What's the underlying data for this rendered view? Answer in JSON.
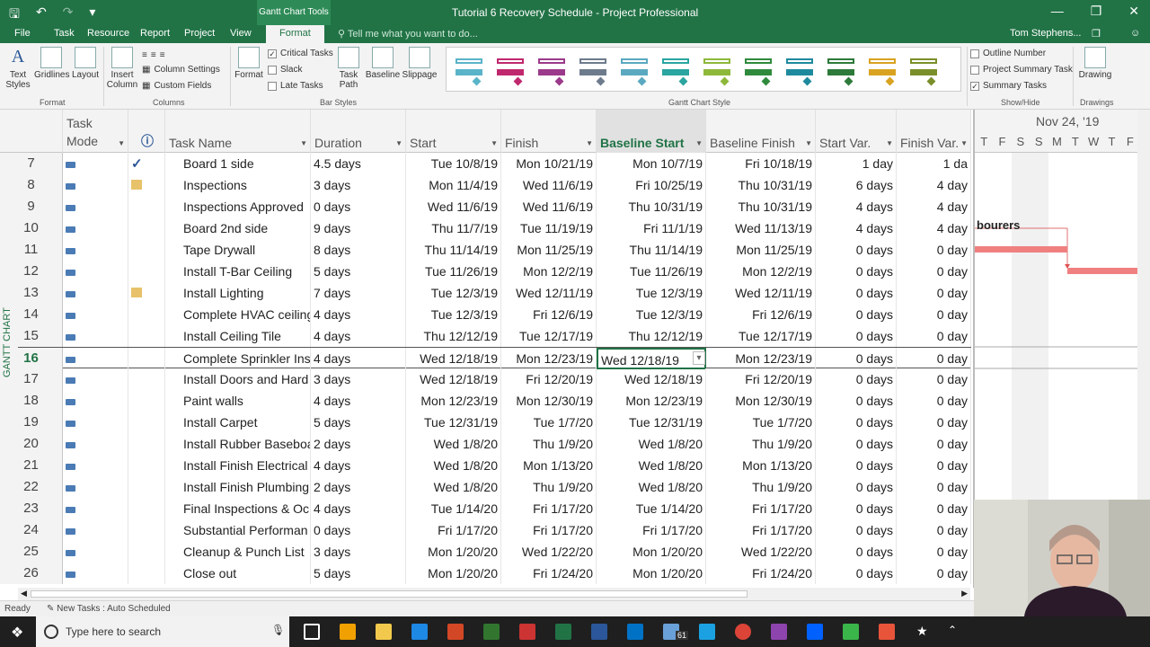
{
  "window": {
    "title": "Tutorial 6 Recovery Schedule - Project Professional",
    "context_tab": "Gantt Chart Tools"
  },
  "tabs": [
    {
      "label": "File"
    },
    {
      "label": "Task"
    },
    {
      "label": "Resource"
    },
    {
      "label": "Report"
    },
    {
      "label": "Project"
    },
    {
      "label": "View"
    },
    {
      "label": "Format"
    }
  ],
  "tell_me": "Tell me what you want to do...",
  "user": "Tom Stephens...",
  "ribbon": {
    "format": {
      "text_styles": "Text Styles",
      "gridlines": "Gridlines",
      "layout": "Layout",
      "label": "Format"
    },
    "columns": {
      "insert_column": "Insert Column",
      "column_settings": "Column Settings",
      "custom_fields": "Custom Fields",
      "label": "Columns"
    },
    "bar_styles": {
      "format": "Format",
      "critical_tasks": "Critical Tasks",
      "slack": "Slack",
      "late_tasks": "Late Tasks",
      "task_path": "Task Path",
      "baseline": "Baseline",
      "slippage": "Slippage",
      "label": "Bar Styles"
    },
    "gantt_style": {
      "label": "Gantt Chart Style",
      "colors": [
        "#5ab4c9",
        "#c0286e",
        "#9b3a8a",
        "#6d7b8c",
        "#5aa9c0",
        "#2aa5a0",
        "#8db83a",
        "#2f8a3c",
        "#1f8a9e",
        "#2d7a3a",
        "#d9a321",
        "#7a8f2a"
      ]
    },
    "show_hide": {
      "outline_number": "Outline Number",
      "project_summary": "Project Summary Task",
      "summary_tasks": "Summary Tasks",
      "label": "Show/Hide"
    },
    "drawings": {
      "drawing": "Drawing",
      "label": "Drawings"
    }
  },
  "columns": {
    "task_mode": "Task Mode",
    "task_name": "Task Name",
    "duration": "Duration",
    "start": "Start",
    "finish": "Finish",
    "baseline_start": "Baseline Start",
    "baseline_finish": "Baseline Finish",
    "start_var": "Start Var.",
    "finish_var": "Finish Var."
  },
  "rows": [
    {
      "id": "7",
      "info": "check",
      "name": "Board 1 side",
      "duration": "4.5 days",
      "start": "Tue 10/8/19",
      "finish": "Mon 10/21/19",
      "bstart": "Mon 10/7/19",
      "bfinish": "Fri 10/18/19",
      "svar": "1 day",
      "fvar": "1 da"
    },
    {
      "id": "8",
      "info": "note",
      "name": "Inspections",
      "duration": "3 days",
      "start": "Mon 11/4/19",
      "finish": "Wed 11/6/19",
      "bstart": "Fri 10/25/19",
      "bfinish": "Thu 10/31/19",
      "svar": "6 days",
      "fvar": "4 day"
    },
    {
      "id": "9",
      "info": "",
      "name": "Inspections Approved",
      "duration": "0 days",
      "start": "Wed 11/6/19",
      "finish": "Wed 11/6/19",
      "bstart": "Thu 10/31/19",
      "bfinish": "Thu 10/31/19",
      "svar": "4 days",
      "fvar": "4 day"
    },
    {
      "id": "10",
      "info": "",
      "name": "Board 2nd side",
      "duration": "9 days",
      "start": "Thu 11/7/19",
      "finish": "Tue 11/19/19",
      "bstart": "Fri 11/1/19",
      "bfinish": "Wed 11/13/19",
      "svar": "4 days",
      "fvar": "4 day"
    },
    {
      "id": "11",
      "info": "",
      "name": "Tape Drywall",
      "duration": "8 days",
      "start": "Thu 11/14/19",
      "finish": "Mon 11/25/19",
      "bstart": "Thu 11/14/19",
      "bfinish": "Mon 11/25/19",
      "svar": "0 days",
      "fvar": "0 day"
    },
    {
      "id": "12",
      "info": "",
      "name": "Install T-Bar Ceiling",
      "duration": "5 days",
      "start": "Tue 11/26/19",
      "finish": "Mon 12/2/19",
      "bstart": "Tue 11/26/19",
      "bfinish": "Mon 12/2/19",
      "svar": "0 days",
      "fvar": "0 day"
    },
    {
      "id": "13",
      "info": "note",
      "name": "Install Lighting",
      "duration": "7 days",
      "start": "Tue 12/3/19",
      "finish": "Wed 12/11/19",
      "bstart": "Tue 12/3/19",
      "bfinish": "Wed 12/11/19",
      "svar": "0 days",
      "fvar": "0 day"
    },
    {
      "id": "14",
      "info": "",
      "name": "Complete HVAC ceiling",
      "duration": "4 days",
      "start": "Tue 12/3/19",
      "finish": "Fri 12/6/19",
      "bstart": "Tue 12/3/19",
      "bfinish": "Fri 12/6/19",
      "svar": "0 days",
      "fvar": "0 day"
    },
    {
      "id": "15",
      "info": "",
      "name": "Install Ceiling Tile",
      "duration": "4 days",
      "start": "Thu 12/12/19",
      "finish": "Tue 12/17/19",
      "bstart": "Thu 12/12/19",
      "bfinish": "Tue 12/17/19",
      "svar": "0 days",
      "fvar": "0 day"
    },
    {
      "id": "16",
      "info": "",
      "name": "Complete Sprinkler Ins",
      "duration": "4 days",
      "start": "Wed 12/18/19",
      "finish": "Mon 12/23/19",
      "bstart": "Wed 12/18/19",
      "bfinish": "Mon 12/23/19",
      "svar": "0 days",
      "fvar": "0 day"
    },
    {
      "id": "17",
      "info": "",
      "name": "Install Doors and Hard",
      "duration": "3 days",
      "start": "Wed 12/18/19",
      "finish": "Fri 12/20/19",
      "bstart": "Wed 12/18/19",
      "bfinish": "Fri 12/20/19",
      "svar": "0 days",
      "fvar": "0 day"
    },
    {
      "id": "18",
      "info": "",
      "name": "Paint walls",
      "duration": "4 days",
      "start": "Mon 12/23/19",
      "finish": "Mon 12/30/19",
      "bstart": "Mon 12/23/19",
      "bfinish": "Mon 12/30/19",
      "svar": "0 days",
      "fvar": "0 day"
    },
    {
      "id": "19",
      "info": "",
      "name": "Install Carpet",
      "duration": "5 days",
      "start": "Tue 12/31/19",
      "finish": "Tue 1/7/20",
      "bstart": "Tue 12/31/19",
      "bfinish": "Tue 1/7/20",
      "svar": "0 days",
      "fvar": "0 day"
    },
    {
      "id": "20",
      "info": "",
      "name": "Install Rubber Baseboa",
      "duration": "2 days",
      "start": "Wed 1/8/20",
      "finish": "Thu 1/9/20",
      "bstart": "Wed 1/8/20",
      "bfinish": "Thu 1/9/20",
      "svar": "0 days",
      "fvar": "0 day"
    },
    {
      "id": "21",
      "info": "",
      "name": "Install Finish Electrical",
      "duration": "4 days",
      "start": "Wed 1/8/20",
      "finish": "Mon 1/13/20",
      "bstart": "Wed 1/8/20",
      "bfinish": "Mon 1/13/20",
      "svar": "0 days",
      "fvar": "0 day"
    },
    {
      "id": "22",
      "info": "",
      "name": "Install Finish Plumbing",
      "duration": "2 days",
      "start": "Wed 1/8/20",
      "finish": "Thu 1/9/20",
      "bstart": "Wed 1/8/20",
      "bfinish": "Thu 1/9/20",
      "svar": "0 days",
      "fvar": "0 day"
    },
    {
      "id": "23",
      "info": "",
      "name": "Final Inspections & Oc",
      "duration": "4 days",
      "start": "Tue 1/14/20",
      "finish": "Fri 1/17/20",
      "bstart": "Tue 1/14/20",
      "bfinish": "Fri 1/17/20",
      "svar": "0 days",
      "fvar": "0 day"
    },
    {
      "id": "24",
      "info": "",
      "name": "Substantial Performan",
      "duration": "0 days",
      "start": "Fri 1/17/20",
      "finish": "Fri 1/17/20",
      "bstart": "Fri 1/17/20",
      "bfinish": "Fri 1/17/20",
      "svar": "0 days",
      "fvar": "0 day"
    },
    {
      "id": "25",
      "info": "",
      "name": "Cleanup & Punch List",
      "duration": "3 days",
      "start": "Mon 1/20/20",
      "finish": "Wed 1/22/20",
      "bstart": "Mon 1/20/20",
      "bfinish": "Wed 1/22/20",
      "svar": "0 days",
      "fvar": "0 day"
    },
    {
      "id": "26",
      "info": "",
      "name": "Close out",
      "duration": "5 days",
      "start": "Mon 1/20/20",
      "finish": "Fri 1/24/20",
      "bstart": "Mon 1/20/20",
      "bfinish": "Fri 1/24/20",
      "svar": "0 days",
      "fvar": "0 day"
    }
  ],
  "current_row": "16",
  "chart": {
    "week_label": "Nov 24, '19",
    "days": [
      "T",
      "F",
      "S",
      "S",
      "M",
      "T",
      "W",
      "T",
      "F"
    ],
    "resource_label": "bourers",
    "bar_color": "#f08080"
  },
  "view_label": "GANTT CHART",
  "status": {
    "ready": "Ready",
    "new_tasks": "New Tasks : Auto Scheduled"
  },
  "taskbar": {
    "search_placeholder": "Type here to search",
    "mail_count": "61"
  }
}
